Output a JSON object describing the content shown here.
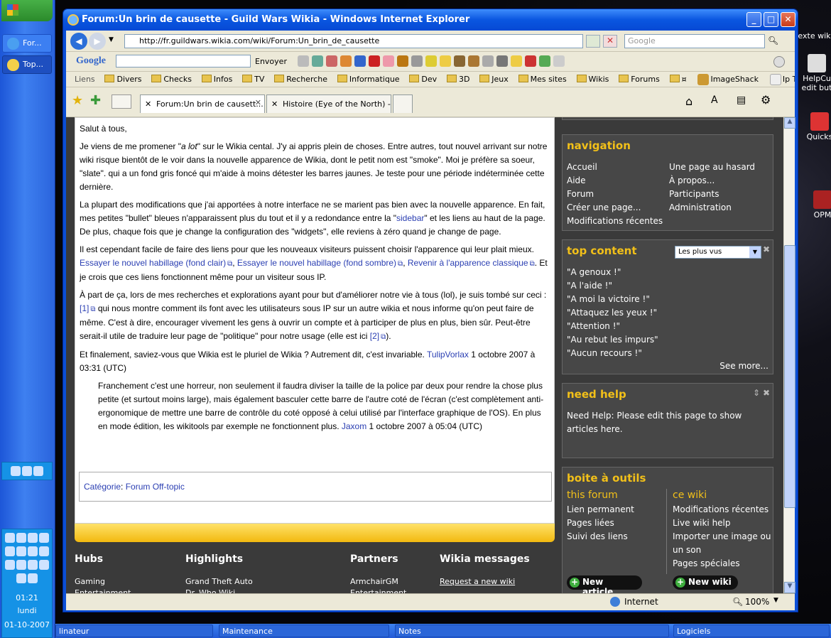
{
  "desktop": {
    "icons": [
      "exte wiki",
      "HelpCu edit but",
      "Quicks",
      "OPM"
    ]
  },
  "vtaskbar": {
    "start_label": "",
    "tasks": [
      "For...",
      "Top..."
    ],
    "clock": {
      "time": "01:21",
      "day": "lundi",
      "date": "01-10-2007"
    }
  },
  "htaskbar": {
    "items": [
      "linateur",
      "Maintenance",
      "Notes",
      "Logiciels"
    ]
  },
  "window": {
    "title": "Forum:Un brin de causette - Guild Wars Wikia - Windows Internet Explorer",
    "address": "http://fr.guildwars.wikia.com/wiki/Forum:Un_brin_de_causette",
    "search_placeholder": "Google",
    "google_toolbar": {
      "label": "Google",
      "send": "Envoyer"
    },
    "links_label": "Liens",
    "favorites": [
      "Divers",
      "Checks",
      "Infos",
      "TV",
      "Recherche",
      "Informatique",
      "Dev",
      "3D",
      "Jeux",
      "Mes sites",
      "Wikis",
      "Forums",
      "¤",
      "ImageShack",
      "Ip Tools"
    ],
    "tabs": [
      {
        "label": "Forum:Un brin de causett...",
        "active": true
      },
      {
        "label": "Histoire (Eye of the North) - ...",
        "active": false
      }
    ],
    "status": {
      "zone": "Internet",
      "zoom": "100%"
    }
  },
  "article": {
    "p1": "Salut à tous,",
    "p2a": "Je viens de me promener \"",
    "p2em": "a lot",
    "p2b": "\" sur le Wikia cental. J'y ai appris plein de choses. Entre autres, tout nouvel arrivant sur notre wiki risque bientôt de le voir dans la nouvelle apparence de Wikia, dont le petit nom est \"smoke\". Moi je préfère sa soeur, \"slate\". qui a un fond gris foncé qui m'aide à moins détester les barres jaunes. Je teste pour une période indéterminée cette dernière.",
    "p3a": "La plupart des modifications que j'ai apportées à notre interface ne se marient pas bien avec la nouvelle apparence. En fait, mes petites \"bullet\" bleues n'apparaissent plus du tout et il y a redondance entre la \"",
    "p3link": "sidebar",
    "p3b": "\" et les liens au haut de la page. De plus, chaque fois que je change la configuration des \"widgets\", elle reviens à zéro quand je change de page.",
    "p4a": "Il est cependant facile de faire des liens pour que les nouveaux visiteurs puissent choisir l'apparence qui leur plait mieux. ",
    "p4l1": "Essayer le nouvel habillage (fond clair)",
    "p4sep": ", ",
    "p4l2": "Essayer le nouvel habillage (fond sombre)",
    "p4sep2": ", ",
    "p4l3": "Revenir à l'apparence classique",
    "p4b": ". Et je crois que ces liens fonctionnent même pour un visiteur sous IP.",
    "p5a": "À part de ça, lors de mes recherches et explorations ayant pour but d'améliorer notre vie à tous (lol), je suis tombé sur ceci : ",
    "p5l1": "[1]",
    "p5b": " qui nous montre comment ils font avec les utilisateurs sous IP sur un autre wikia et nous informe qu'on peut faire de même. C'est à dire, encourager vivement les gens à ouvrir un compte et à participer de plus en plus, bien sûr. Peut-être serait-il utile de traduire leur page de \"politique\" pour notre usage (elle est ici ",
    "p5l2": "[2]",
    "p5c": ").",
    "p6a": "Et finalement, saviez-vous que Wikia est le pluriel de Wikia ? Autrement dit, c'est invariable. ",
    "p6user": "TulipVorlax",
    "p6b": " 1 octobre 2007 à 03:31 (UTC)",
    "r1": "Franchement c'est une horreur, non seulement il faudra diviser la taille de la police par deux pour rendre la chose plus petite (et surtout moins large), mais également basculer cette barre de l'autre coté de l'écran (c'est complètement anti-ergonomique de mettre une barre de contrôle du coté opposé à celui utilisé par l'interface graphique de l'OS). En plus en mode édition, les wikitools par exemple ne fonctionnent plus. ",
    "r1user": "Jaxom",
    "r1b": " 1 octobre 2007 à 05:04 (UTC)",
    "category_label": "Catégorie",
    "category_sep": ": ",
    "category_value": "Forum Off-topic"
  },
  "footer": {
    "hubs": {
      "title": "Hubs",
      "items": [
        "Gaming",
        "Entertainment"
      ]
    },
    "highlights": {
      "title": "Highlights",
      "items": [
        "Grand Theft Auto",
        "Dr. Who Wiki"
      ]
    },
    "partners": {
      "title": "Partners",
      "items": [
        "ArmchairGM",
        "Entertainment"
      ]
    },
    "messages": {
      "title": "Wikia messages",
      "link": "Request a new wiki"
    }
  },
  "sidebar": {
    "navigation": {
      "title": "navigation",
      "left": [
        "Accueil",
        "Aide",
        "Forum",
        "Créer une page...",
        "Modifications récentes"
      ],
      "right": [
        "Une page au hasard",
        "À propos...",
        "Participants",
        "Administration"
      ]
    },
    "top_content": {
      "title": "top content",
      "select": "Les plus vus",
      "items": [
        "\"A genoux !\"",
        "\"A l'aide !\"",
        "\"A moi la victoire !\"",
        "\"Attaquez les yeux !\"",
        "\"Attention !\"",
        "\"Au rebut les impurs\"",
        "\"Aucun recours !\""
      ],
      "more": "See more..."
    },
    "need_help": {
      "title": "need help",
      "text": "Need Help: Please edit this page to show articles here."
    },
    "toolbox": {
      "title": "boite à outils",
      "forum_title": "this forum",
      "forum_items": [
        "Lien permanent",
        "Pages liées",
        "Suivi des liens"
      ],
      "wiki_title": "ce wiki",
      "wiki_items": [
        "Modifications récentes",
        "Live wiki help",
        "Importer une image ou un son",
        "Pages spéciales"
      ],
      "new_article": "New article",
      "new_wiki": "New wiki"
    }
  }
}
